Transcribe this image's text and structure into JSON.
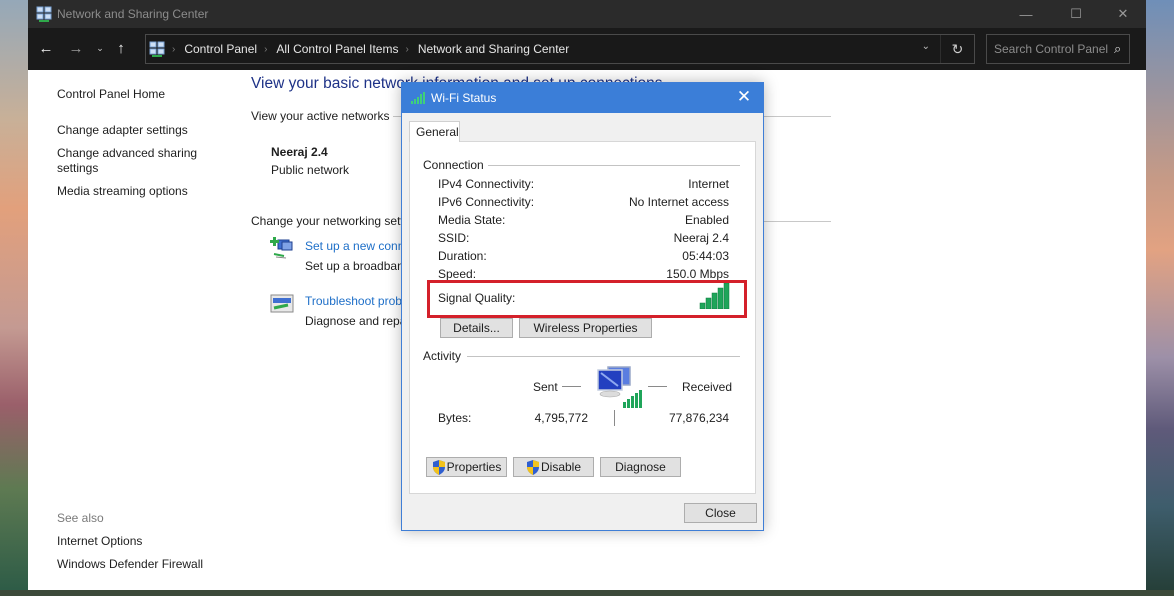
{
  "window": {
    "title": "Network and Sharing Center",
    "controls": {
      "minimize": "—",
      "maximize": "☐",
      "close": "✕"
    }
  },
  "navigation": {
    "back": "←",
    "forward": "→",
    "recent": "⌄",
    "up": "↑",
    "breadcrumb": [
      "Control Panel",
      "All Control Panel Items",
      "Network and Sharing Center"
    ],
    "separator": "›",
    "dropdown": "⌄",
    "refresh": "↻",
    "search_placeholder": "Search Control Panel",
    "search_icon": "⚲"
  },
  "sidebar": {
    "items": [
      {
        "label": "Control Panel Home"
      },
      {
        "label": "Change adapter settings"
      },
      {
        "label": "Change advanced sharing settings",
        "line1": "Change advanced sharing",
        "line2": "settings"
      },
      {
        "label": "Media streaming options"
      }
    ],
    "see_also_label": "See also",
    "see_also": [
      {
        "label": "Internet Options"
      },
      {
        "label": "Windows Defender Firewall"
      }
    ]
  },
  "main": {
    "heading": "View your basic network information and set up connections",
    "active_networks_title": "View your active networks",
    "network_name": "Neeraj 2.4",
    "network_type": "Public network",
    "change_settings_title": "Change your networking settings",
    "tasks": [
      {
        "link": "Set up a new connection or network",
        "description": "Set up a broadband, dial-up, or VPN connection; or set up a router or access point."
      },
      {
        "link": "Troubleshoot problems",
        "description": "Diagnose and repair network problems, or get troubleshooting information."
      }
    ]
  },
  "dialog": {
    "title": "Wi-Fi Status",
    "close": "✕",
    "tab": "General",
    "connection_label": "Connection",
    "rows": [
      {
        "label": "IPv4 Connectivity:",
        "value": "Internet"
      },
      {
        "label": "IPv6 Connectivity:",
        "value": "No Internet access"
      },
      {
        "label": "Media State:",
        "value": "Enabled"
      },
      {
        "label": "SSID:",
        "value": "Neeraj 2.4"
      },
      {
        "label": "Duration:",
        "value": "05:44:03"
      },
      {
        "label": "Speed:",
        "value": "150.0 Mbps"
      }
    ],
    "signal_quality_label": "Signal Quality:",
    "signal_bars": 5,
    "signal_bars_max": 5,
    "details_button": "Details...",
    "wireless_properties_button": "Wireless Properties",
    "activity_label": "Activity",
    "sent_label": "Sent",
    "received_label": "Received",
    "bytes_label": "Bytes:",
    "bytes_sent": "4,795,772",
    "bytes_received": "77,876,234",
    "properties_button": "Properties",
    "disable_button": "Disable",
    "diagnose_button": "Diagnose",
    "close_button": "Close"
  },
  "colors": {
    "accent_blue": "#3b7ed8",
    "link_blue": "#1e6fc8",
    "heading_blue": "#1e3287",
    "highlight_red": "#d4202a",
    "signal_green": "#1fa55a"
  }
}
